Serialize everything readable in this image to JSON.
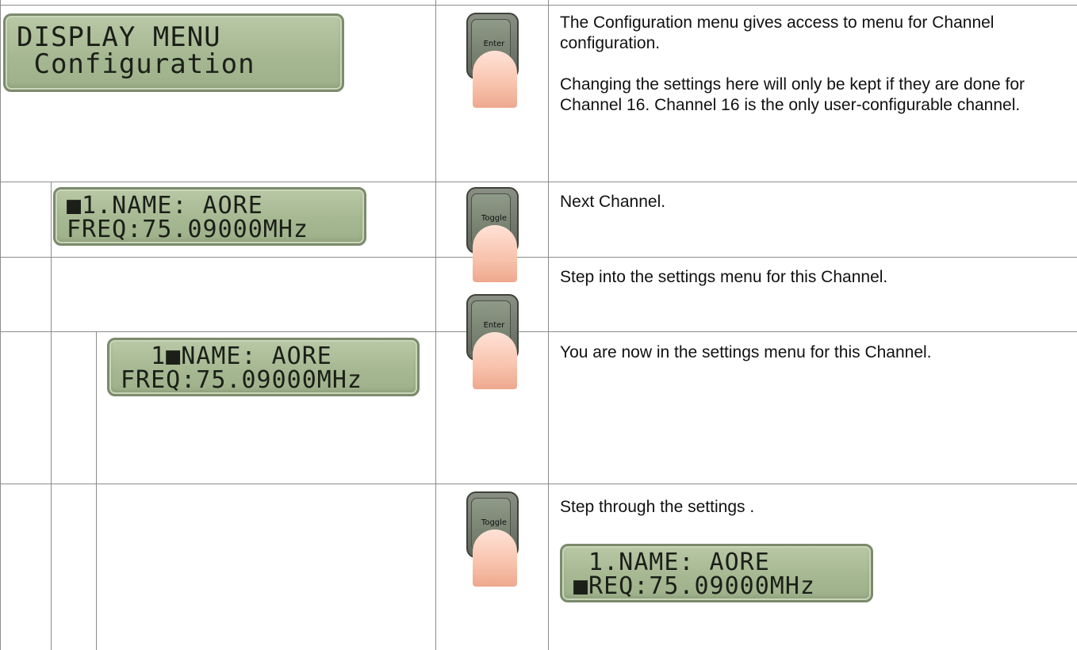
{
  "rows": [
    {
      "lcd_lines": [
        "DISPLAY MENU",
        " Configuration"
      ],
      "button": "Enter",
      "description": [
        "The Configuration menu gives access to menu for Channel configuration.",
        "Changing the settings here will only be kept if they are done for Channel 16. Channel 16 is the only user-configurable channel."
      ]
    },
    {
      "lcd_lines": [
        "■1.NAME: AORE",
        "FREQ:75.09000MHz"
      ],
      "button": "Toggle",
      "description": [
        "Next Channel."
      ]
    },
    {
      "button": "Enter",
      "description": [
        "Step into the settings menu for this Channel."
      ]
    },
    {
      "lcd_lines": [
        "  1■NAME: AORE",
        "FREQ:75.09000MHz"
      ],
      "description": [
        "You are now in the settings menu for this Channel."
      ]
    },
    {
      "button": "Toggle",
      "description": [
        "Step through the settings ."
      ],
      "lcd_lines": [
        " 1.NAME: AORE",
        "■REQ:75.09000MHz"
      ]
    }
  ]
}
